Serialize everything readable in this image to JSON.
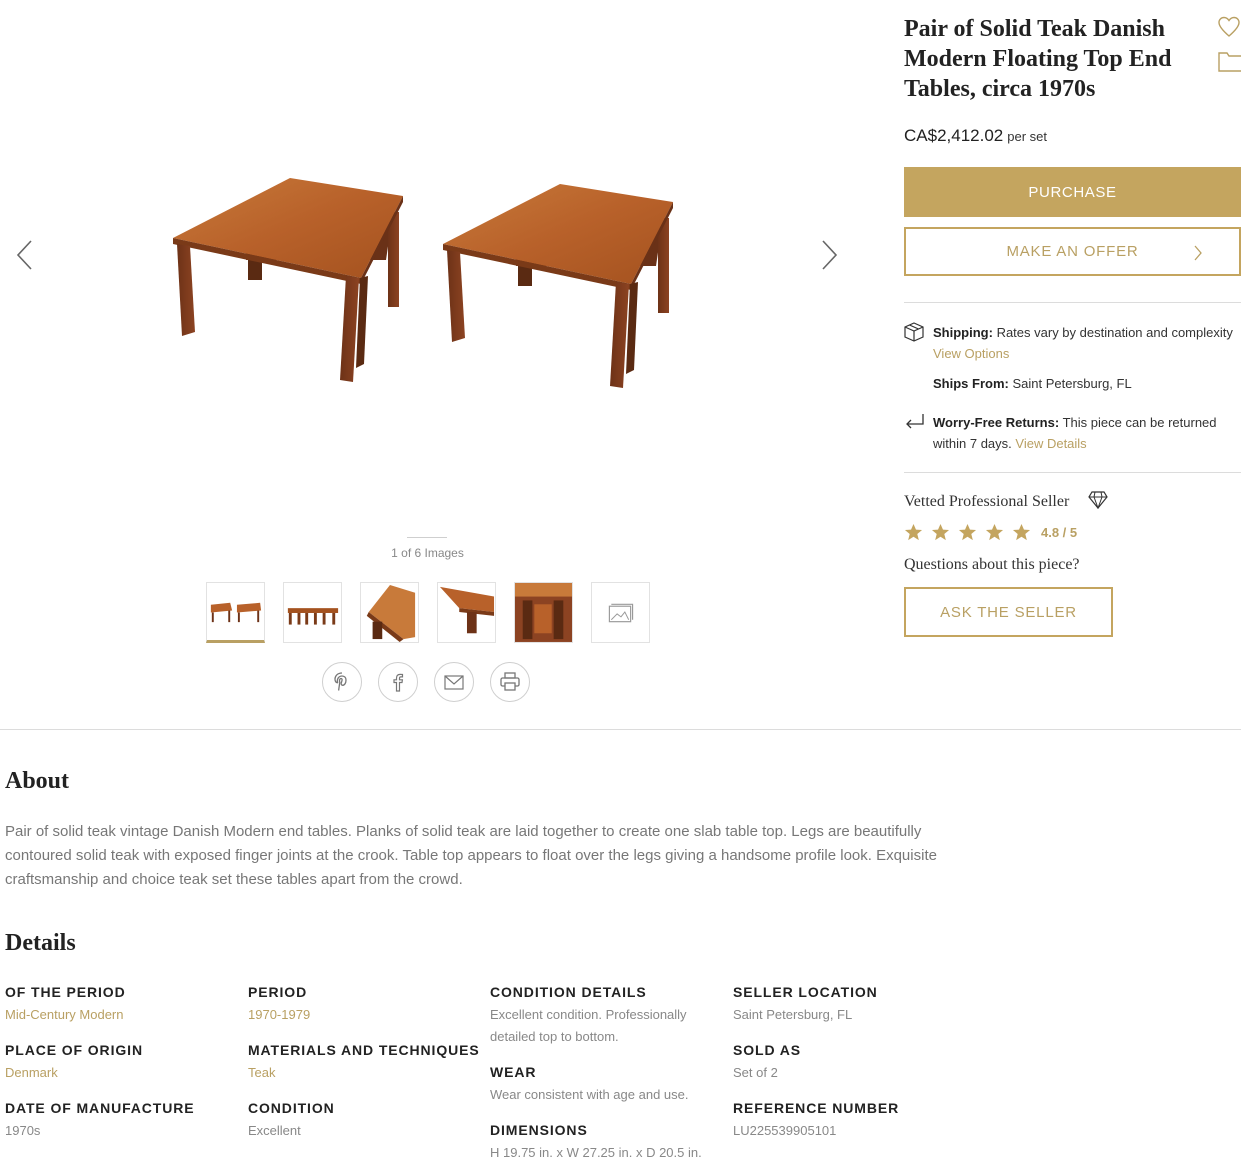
{
  "product": {
    "title": "Pair of Solid Teak Danish Modern Floating Top End Tables, circa 1970s",
    "price": "CA$2,412.02",
    "price_unit": "per set",
    "purchase_label": "PURCHASE",
    "offer_label": "MAKE AN OFFER"
  },
  "gallery": {
    "counter": "1 of 6 Images",
    "thumbnails": [
      "thumb-pair",
      "thumb-side",
      "thumb-corner",
      "thumb-top",
      "thumb-detail",
      "more-images-icon"
    ],
    "share": [
      "pinterest-icon",
      "facebook-icon",
      "email-icon",
      "print-icon"
    ]
  },
  "shipping": {
    "shipping_label": "Shipping:",
    "shipping_text": "Rates vary by destination and complexity",
    "view_options": "View Options",
    "ships_from_label": "Ships From:",
    "ships_from_value": "Saint Petersburg, FL",
    "returns_label": "Worry-Free Returns:",
    "returns_text_1": "This piece can be returned",
    "returns_text_2": "within 7 days.",
    "view_details": "View Details"
  },
  "seller": {
    "vetted": "Vetted Professional Seller",
    "rating": "4.8 / 5",
    "stars": 5,
    "questions": "Questions about this piece?",
    "ask_label": "ASK THE SELLER"
  },
  "about": {
    "heading": "About",
    "text": "Pair of solid teak vintage Danish Modern end tables. Planks of solid teak are laid together to create one slab table top. Legs are beautifully contoured solid teak with exposed finger joints at the crook. Table top appears to float over the legs giving a handsome profile look. Exquisite craftsmanship and choice teak set these tables apart from the crowd."
  },
  "details": {
    "heading": "Details",
    "columns": [
      [
        {
          "label": "OF THE PERIOD",
          "value": "Mid-Century Modern",
          "link": true
        },
        {
          "label": "PLACE OF ORIGIN",
          "value": "Denmark",
          "link": true
        },
        {
          "label": "DATE OF MANUFACTURE",
          "value": "1970s",
          "link": false
        }
      ],
      [
        {
          "label": "PERIOD",
          "value": "1970-1979",
          "link": true
        },
        {
          "label": "MATERIALS AND TECHNIQUES",
          "value": "Teak",
          "link": true
        },
        {
          "label": "CONDITION",
          "value": "Excellent",
          "link": false
        }
      ],
      [
        {
          "label": "CONDITION DETAILS",
          "value": "Excellent condition. Professionally detailed top to bottom.",
          "link": false
        },
        {
          "label": "WEAR",
          "value": "Wear consistent with age and use.",
          "link": false
        },
        {
          "label": "DIMENSIONS",
          "value": "H 19.75 in. x W 27.25 in. x D 20.5 in.",
          "link": false
        }
      ],
      [
        {
          "label": "SELLER LOCATION",
          "value": "Saint Petersburg, FL",
          "link": false
        },
        {
          "label": "SOLD AS",
          "value": "Set of 2",
          "link": false
        },
        {
          "label": "REFERENCE NUMBER",
          "value": "LU225539905101",
          "link": false
        }
      ]
    ]
  },
  "colors": {
    "gold": "#c4a55f",
    "gold_text": "#b9a063",
    "teak": "#b5642a"
  }
}
